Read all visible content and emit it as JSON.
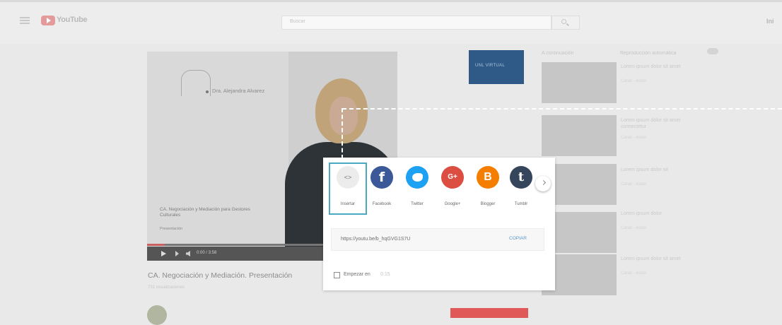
{
  "header": {
    "logo_text": "YouTube",
    "search_placeholder": "Buscar",
    "signin": "Ini"
  },
  "video": {
    "presenter_name": "Dra. Alejandra Alvarez",
    "caption_title": "CA. Negociación y Mediación para Gestores Culturales",
    "caption_sub": "Presentación",
    "time": "0:00 / 3:58",
    "progress_fraction": 0.07,
    "title": "CA. Negociación y Mediación. Presentación",
    "channel_meta": "731 visualizaciones"
  },
  "ad": {
    "text": "UNL VIRTUAL"
  },
  "sidebar": {
    "header_left": "A continuación",
    "header_right": "Reproducción automática",
    "items": [
      {
        "title": "Lorem ipsum dolor sit amet",
        "meta": "Canal · vistas"
      },
      {
        "title": "Lorem ipsum dolor sit amet consectetur",
        "meta": "Canal · vistas"
      },
      {
        "title": "Lorem ipsum dolor sit",
        "meta": "Canal · vistas"
      },
      {
        "title": "Lorem ipsum dolor",
        "meta": "Canal · vistas"
      },
      {
        "title": "Lorem ipsum dolor sit amet",
        "meta": "Canal · vistas"
      }
    ]
  },
  "share_dialog": {
    "options": [
      {
        "label": "Insertar",
        "glyph": "<>"
      },
      {
        "label": "Facebook",
        "glyph": "f"
      },
      {
        "label": "Twitter",
        "glyph": ""
      },
      {
        "label": "Google+",
        "glyph": "G+"
      },
      {
        "label": "Blogger",
        "glyph": "B"
      },
      {
        "label": "Tumblr",
        "glyph": "t"
      }
    ],
    "link": "https://youtu.be/b_hqGVG1S7U",
    "copy_label": "COPIAR",
    "start_label": "Empezar en",
    "start_time": "0:15"
  },
  "colors": {
    "embed_highlight": "#4aa8c2",
    "facebook": "#3b5998",
    "twitter": "#1da1f2",
    "googleplus": "#dc4e41",
    "blogger": "#f57d00",
    "tumblr": "#35465c",
    "copy_link": "#5a95c8"
  }
}
